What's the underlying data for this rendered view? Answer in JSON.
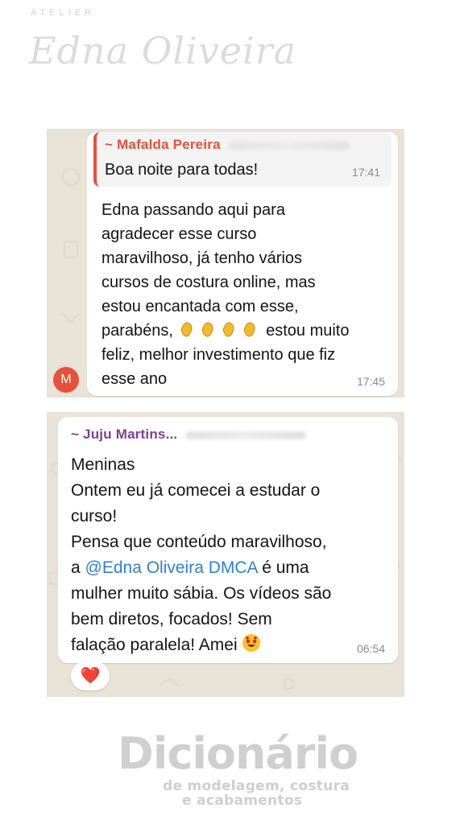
{
  "brand": {
    "small": "ATELIER",
    "script": "Edna Oliveira"
  },
  "chat1": {
    "quoted_sender": "~ Mafalda Pereira",
    "quoted_text": "Boa noite para todas!",
    "quoted_time": "17:41",
    "message_lines": [
      "Edna passando aqui para",
      "agradecer esse curso",
      "maravilhoso, já tenho vários",
      "cursos de costura online, mas",
      "estou encantada com esse,",
      "parabéns,",
      " estou muito",
      "feliz, melhor investimento que fiz",
      "esse ano"
    ],
    "message_time": "17:45",
    "avatar_letter": "M",
    "avatar_color": "#e8503a",
    "sender_color": "#e8503a"
  },
  "chat2": {
    "sender": "~ Juju Martins...",
    "sender_color": "#7b3f98",
    "lines": [
      "Meninas",
      "Ontem eu já comecei a estudar o",
      "curso!",
      "Pensa que conteúdo maravilhoso,",
      "a ",
      "@Edna Oliveira DMCA",
      " é uma",
      "mulher muito sábia. Os vídeos são",
      "bem diretos, focados! Sem",
      "falação paralela! Amei "
    ],
    "time": "06:54",
    "reaction": "❤️",
    "mention_color": "#2f80d1"
  },
  "footer": {
    "title": "Dicionário",
    "subtitle_line1": "de modelagem, costura",
    "subtitle_line2": "e acabamentos"
  }
}
